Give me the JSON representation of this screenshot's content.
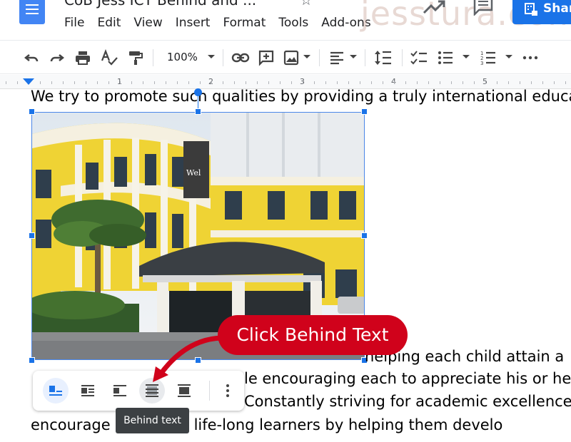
{
  "header": {
    "doc_title": "CoB Jess ICT Behind and ...",
    "share_label": "Shar",
    "watermark": "jesstura.com"
  },
  "menu": [
    "File",
    "Edit",
    "View",
    "Insert",
    "Format",
    "Tools",
    "Add-ons"
  ],
  "toolbar": {
    "zoom": "100%"
  },
  "ruler": {
    "numbers": [
      "1",
      "2",
      "3",
      "4",
      "5"
    ]
  },
  "document": {
    "lines": [
      "We try to promote such qualities by providing a truly international educati",
      "helping each child attain a",
      "le encouraging each to appreciate his or he",
      "Constantly striving for academic excellence, w",
      "encourage      o become life-long learners by helping them develo"
    ]
  },
  "wrap_toolbar": {
    "tooltip": "Behind text",
    "options": [
      "in-line",
      "wrap-text",
      "break-text",
      "behind-text",
      "in-front-of-text",
      "more-options"
    ]
  },
  "annotation": {
    "callout": "Click Behind Text",
    "color": "#d0021b"
  },
  "colors": {
    "accent": "#1a73e8",
    "docs_blue": "#4285f4"
  }
}
